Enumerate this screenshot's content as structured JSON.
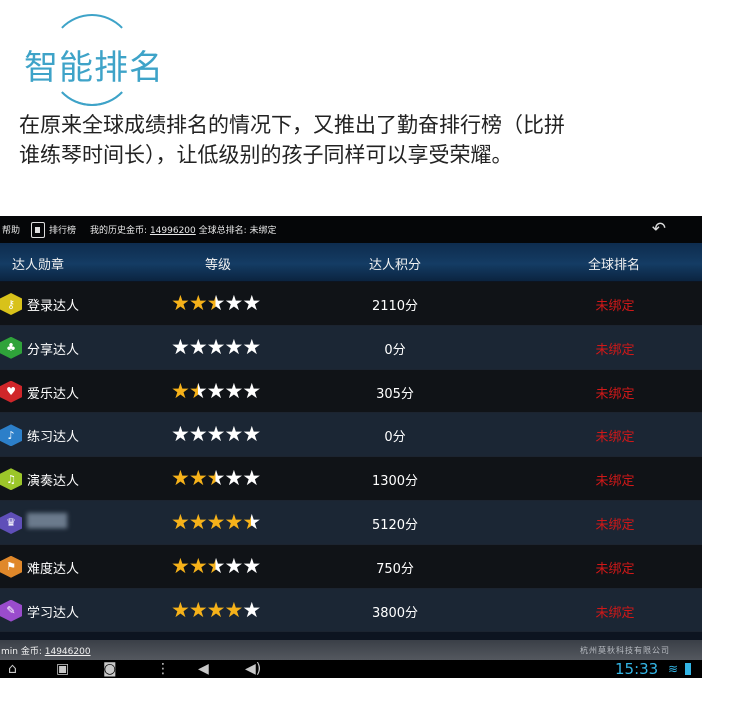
{
  "intro": {
    "heading": "智能排名",
    "description": "在原来全球成绩排名的情况下，又推出了勤奋排行榜（比拼谁练琴时间长），让低级别的孩子同样可以享受荣耀。"
  },
  "topbar": {
    "help_label": "帮助",
    "rank_tab_label": "排行榜",
    "history_prefix": "我的历史金币:",
    "history_coins": "14996200",
    "global_rank_text": "全球总排名: 未绑定",
    "back_icon": "back-arrow-icon"
  },
  "table": {
    "headers": [
      "达人勋章",
      "等级",
      "达人积分",
      "全球排名"
    ],
    "rows": [
      {
        "badge_icon": "key-icon",
        "badge_color": "#d8c21a",
        "badge_glyph": "⚷",
        "name": "登录达人",
        "stars": 2.5,
        "score": "2110分",
        "rank": "未绑定"
      },
      {
        "badge_icon": "clover-icon",
        "badge_color": "#2fa33a",
        "badge_glyph": "♣",
        "name": "分享达人",
        "stars": 0,
        "score": "0分",
        "rank": "未绑定"
      },
      {
        "badge_icon": "heart-icon",
        "badge_color": "#d0262a",
        "badge_glyph": "♥",
        "name": "爱乐达人",
        "stars": 1.5,
        "score": "305分",
        "rank": "未绑定"
      },
      {
        "badge_icon": "note-icon",
        "badge_color": "#2c7fc9",
        "badge_glyph": "♪",
        "name": "练习达人",
        "stars": 0,
        "score": "0分",
        "rank": "未绑定"
      },
      {
        "badge_icon": "horn-icon",
        "badge_color": "#9cc62a",
        "badge_glyph": "♫",
        "name": "演奏达人",
        "stars": 2.5,
        "score": "1300分",
        "rank": "未绑定"
      },
      {
        "badge_icon": "crown-icon",
        "badge_color": "#5f4fb8",
        "badge_glyph": "♛",
        "name": "",
        "stars": 4.5,
        "score": "5120分",
        "rank": "未绑定"
      },
      {
        "badge_icon": "flag-icon",
        "badge_color": "#e0882a",
        "badge_glyph": "⚑",
        "name": "难度达人",
        "stars": 2.5,
        "score": "750分",
        "rank": "未绑定"
      },
      {
        "badge_icon": "pen-icon",
        "badge_color": "#9a4ccc",
        "badge_glyph": "✎",
        "name": "学习达人",
        "stars": 4,
        "score": "3800分",
        "rank": "未绑定"
      }
    ]
  },
  "footer": {
    "gold_prefix": "min 金币:",
    "gold_value": "14946200",
    "company": "杭州莫秋科技有限公司"
  },
  "navbar": {
    "time": "15:33",
    "icons": [
      "back-icon",
      "home-icon",
      "recent-apps-icon",
      "camera-icon",
      "menu-icon",
      "volume-down-icon",
      "volume-up-icon"
    ]
  },
  "colors": {
    "accent": "#3ea3c8",
    "star_on": "#f6b21a",
    "rank_text": "#d01818",
    "status_blue": "#33b5e5"
  }
}
